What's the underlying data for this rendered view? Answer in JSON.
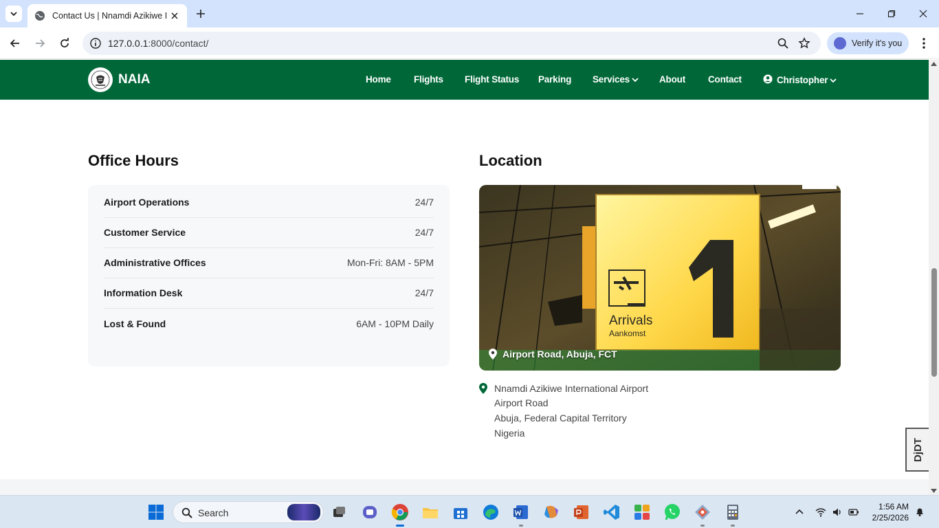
{
  "browser": {
    "tab_title": "Contact Us | Nnamdi Azikiwe In",
    "url_host": "127.0.0.1",
    "url_path": ":8000/contact/",
    "verify_label": "Verify it's you"
  },
  "site": {
    "brand": "NAIA",
    "nav": {
      "home": "Home",
      "flights": "Flights",
      "flight_status": "Flight Status",
      "parking": "Parking",
      "services": "Services",
      "about": "About",
      "contact": "Contact",
      "user": "Christopher"
    }
  },
  "office_hours": {
    "title": "Office Hours",
    "rows": [
      {
        "label": "Airport Operations",
        "value": "24/7"
      },
      {
        "label": "Customer Service",
        "value": "24/7"
      },
      {
        "label": "Administrative Offices",
        "value": "Mon-Fri: 8AM - 5PM"
      },
      {
        "label": "Information Desk",
        "value": "24/7"
      },
      {
        "label": "Lost & Found",
        "value": "6AM - 10PM Daily"
      }
    ]
  },
  "location": {
    "title": "Location",
    "image_caption": "Airport Road, Abuja, FCT",
    "sign_text": "Arrivals",
    "sign_subtext": "Aankomst",
    "sign_number": "1",
    "address_lines": [
      "Nnamdi Azikiwe International Airport",
      "Airport Road",
      "Abuja, Federal Capital Territory",
      "Nigeria"
    ]
  },
  "badge": "DjDT",
  "taskbar": {
    "search_placeholder": "Search",
    "time": "1:56 AM",
    "date": "2/25/2026"
  },
  "colors": {
    "brand_green": "#006838",
    "pin_green": "#006838"
  }
}
